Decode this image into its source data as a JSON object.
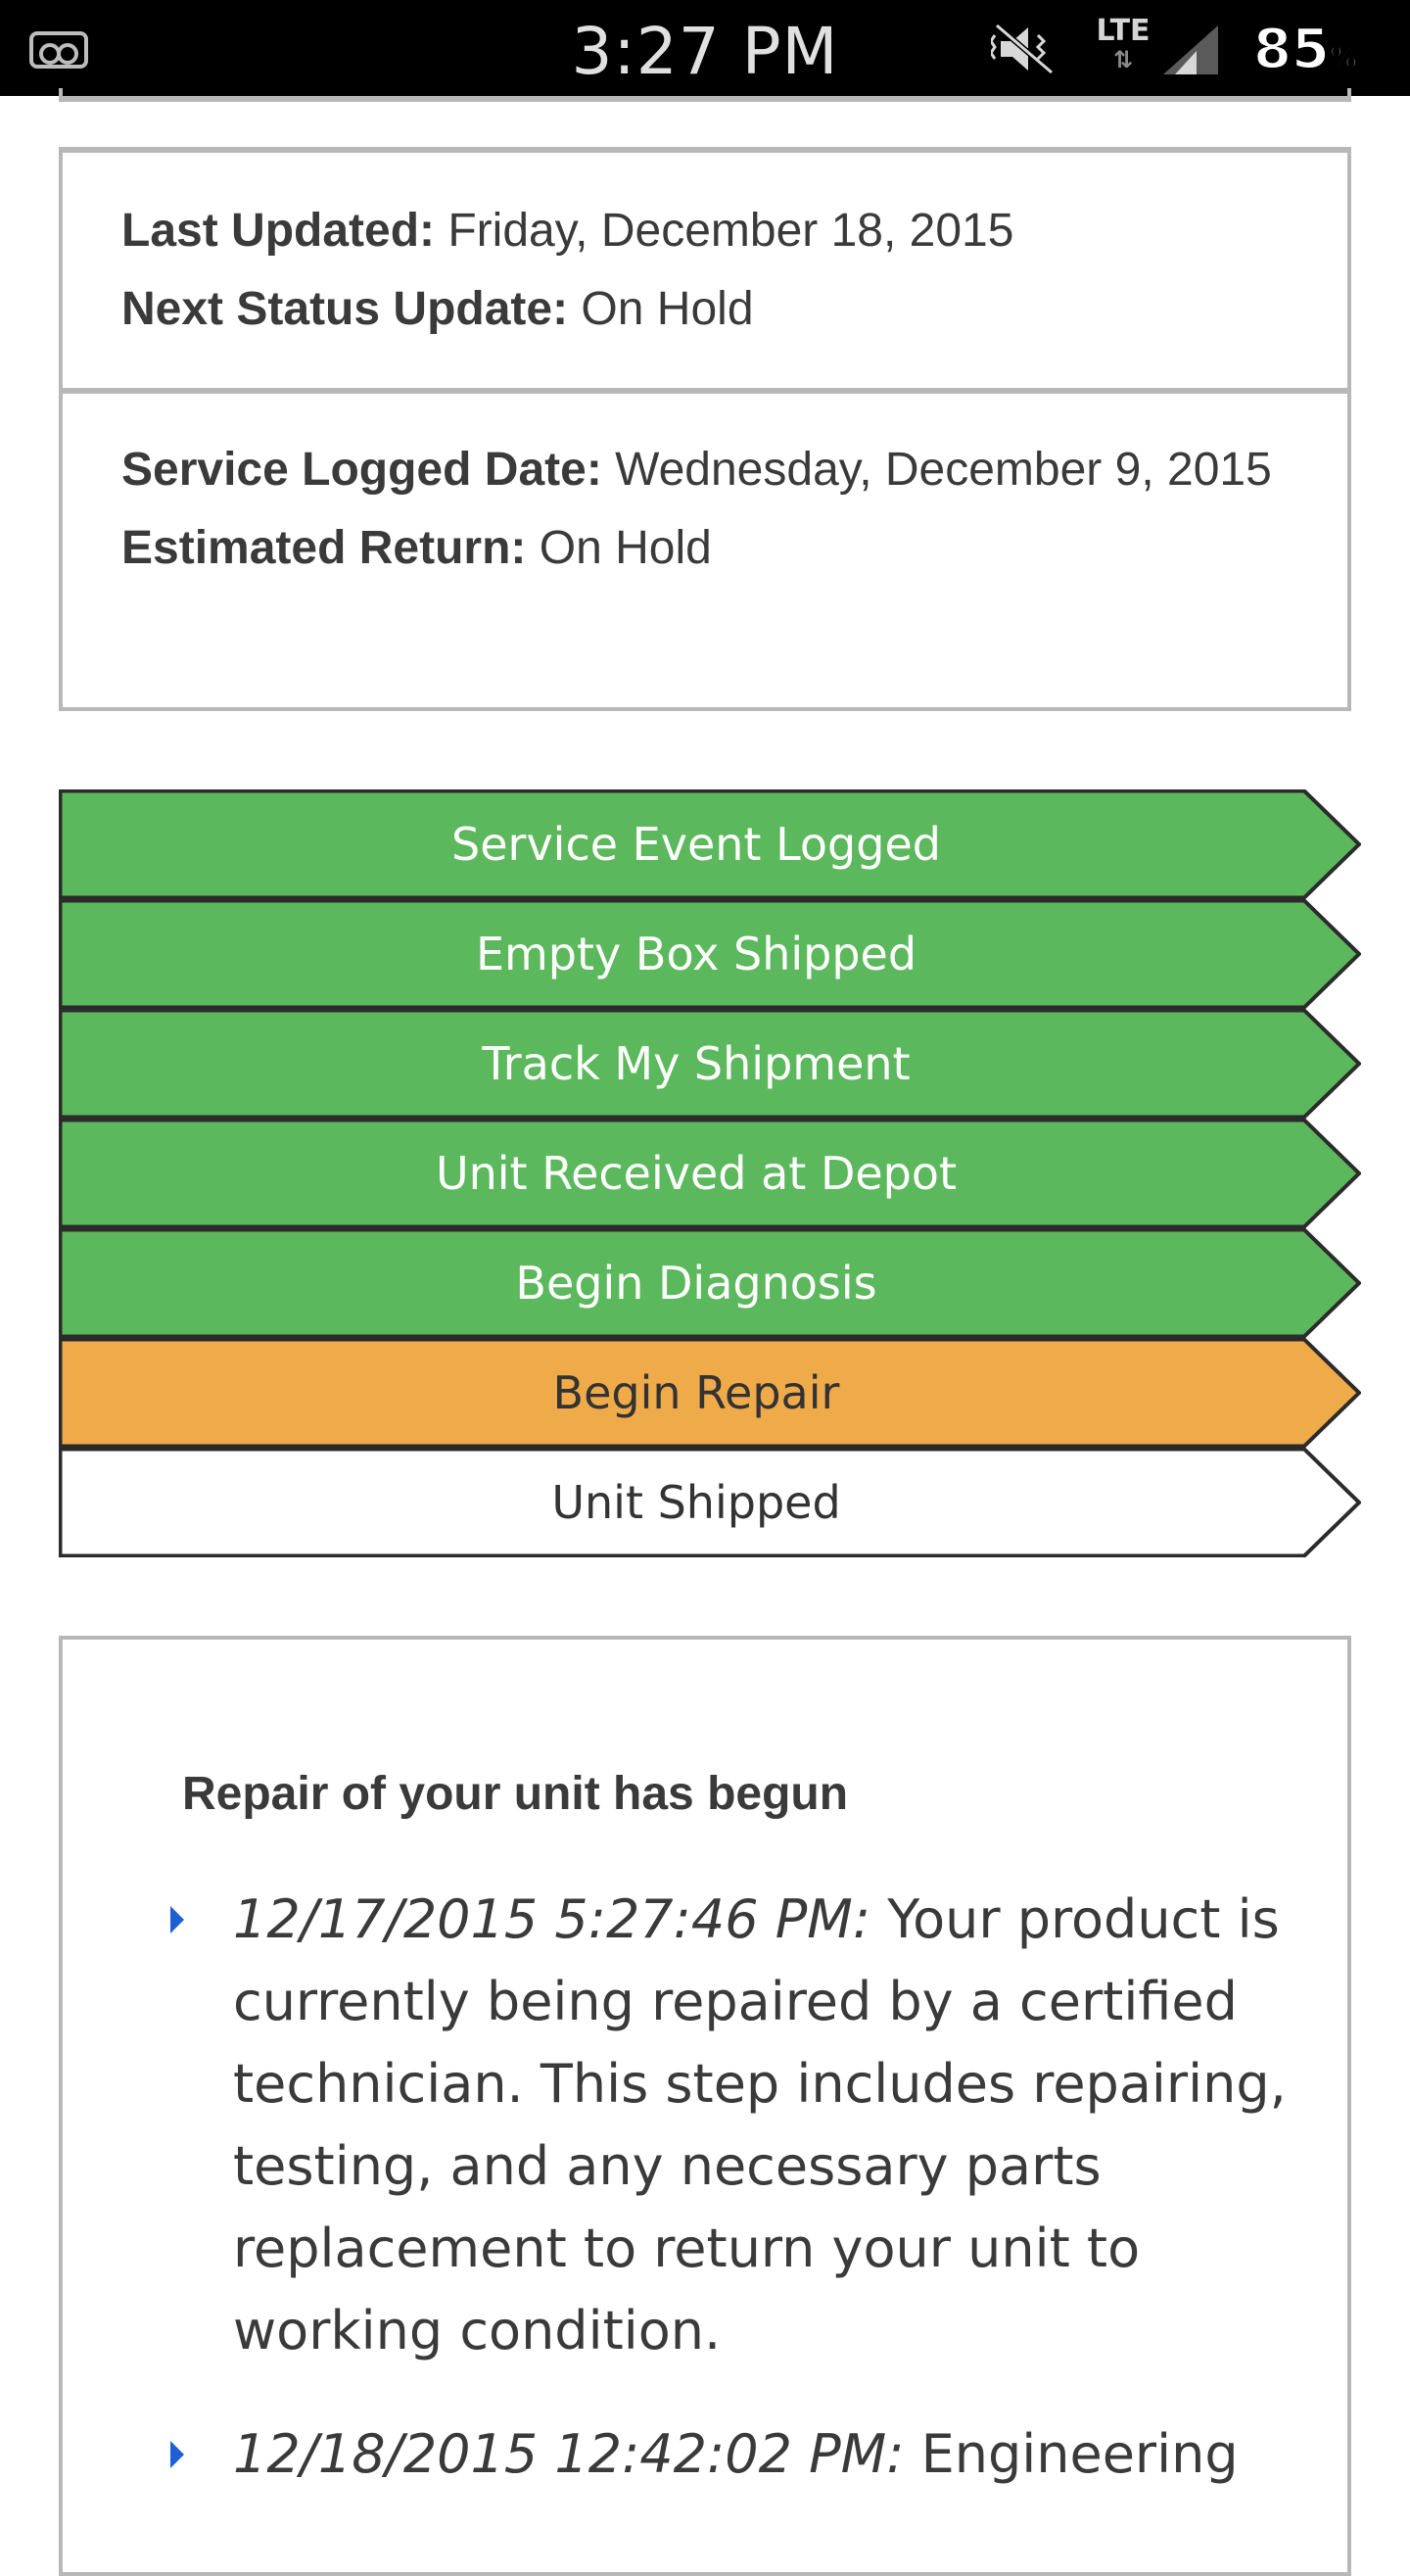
{
  "status_bar": {
    "time": "3:27 PM",
    "network": "LTE",
    "battery": "85",
    "battery_unit": "%",
    "icons": [
      "voicemail-icon",
      "mute-icon",
      "lte-icon",
      "signal-icon",
      "battery-icon"
    ]
  },
  "status_card": {
    "last_updated_label": "Last Updated:",
    "last_updated_value": "Friday, December 18, 2015",
    "next_update_label": "Next Status Update:",
    "next_update_value": "On Hold"
  },
  "service_card": {
    "logged_label": "Service Logged Date:",
    "logged_value": "Wednesday, December 9, 2015",
    "return_label": "Estimated Return:",
    "return_value": "On Hold"
  },
  "colors": {
    "complete": "#5cb85c",
    "current": "#efaa4a",
    "pending": "#ffffff",
    "step_border": "#2b2b2b",
    "bullet": "#1f5fd6"
  },
  "steps": [
    {
      "label": "Service Event Logged",
      "state": "complete"
    },
    {
      "label": "Empty Box Shipped",
      "state": "complete"
    },
    {
      "label": "Track My Shipment",
      "state": "complete"
    },
    {
      "label": "Unit Received at Depot",
      "state": "complete"
    },
    {
      "label": "Begin Diagnosis",
      "state": "complete"
    },
    {
      "label": "Begin Repair",
      "state": "current"
    },
    {
      "label": "Unit Shipped",
      "state": "pending"
    }
  ],
  "detail": {
    "heading": "Repair of your unit has begun",
    "updates": [
      {
        "timestamp": "12/17/2015 5:27:46 PM:",
        "text": "Your product is currently being repaired by a certified technician. This step includes repairing, testing, and any necessary parts replacement to return your unit to working condition."
      },
      {
        "timestamp": "12/18/2015 12:42:02 PM:",
        "text": "Engineering"
      }
    ]
  }
}
